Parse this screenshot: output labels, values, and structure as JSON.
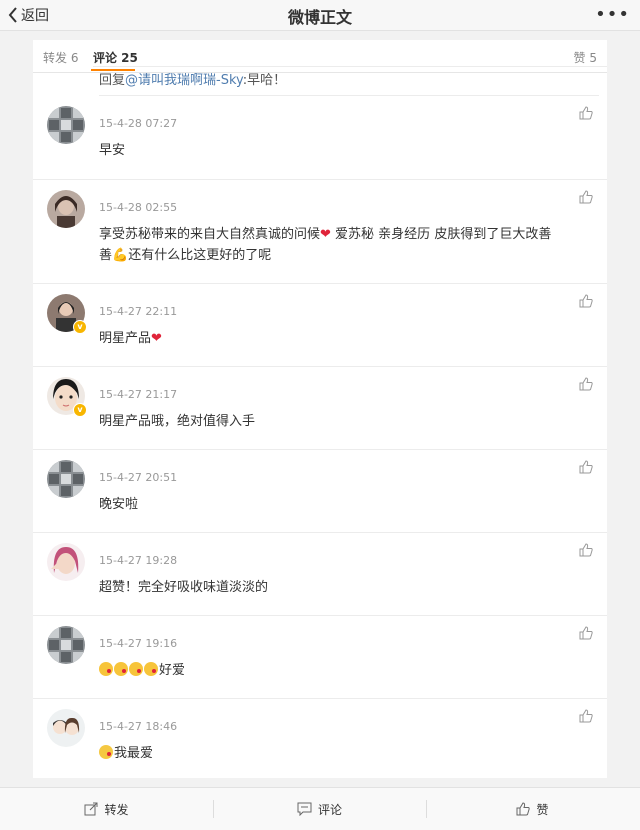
{
  "nav": {
    "back_label": "返回",
    "title": "微博正文",
    "more_label": "•••"
  },
  "tabs": {
    "repost": "转发 6",
    "comment": "评论 25",
    "like": "赞 5"
  },
  "reply_line": {
    "prefix": "回复",
    "mention": "@请叫我瑞啊瑞-Sky",
    "text": ":早哈！"
  },
  "comments": [
    {
      "time": "15-4-28 07:27",
      "text": "早安",
      "verified": false,
      "avatar": "pattern-gray"
    },
    {
      "time": "15-4-28 02:55",
      "text": "享受苏秘带来的来自大自然真诚的问候",
      "text_b": " 爱苏秘 亲身经历 皮肤得到了巨大改善",
      "text_c": "还有什么比这更好的了呢",
      "verified": false,
      "avatar": "person-dark"
    },
    {
      "time": "15-4-27 22:11",
      "text": "明星产品",
      "verified": true,
      "avatar": "person-group"
    },
    {
      "time": "15-4-27 21:17",
      "text": "明星产品哦，绝对值得入手",
      "verified": true,
      "avatar": "girl-face"
    },
    {
      "time": "15-4-27 20:51",
      "text": "晚安啦",
      "verified": false,
      "avatar": "pattern-gray"
    },
    {
      "time": "15-4-27 19:28",
      "text": "超赞！完全好吸收味道淡淡的",
      "verified": false,
      "avatar": "girl-pink"
    },
    {
      "time": "15-4-27 19:16",
      "text": "好爱",
      "verified": false,
      "avatar": "pattern-gray"
    },
    {
      "time": "15-4-27 18:46",
      "text": "我最爱",
      "verified": false,
      "avatar": "cartoon-couple"
    }
  ],
  "bottom": {
    "repost": "转发",
    "comment": "评论",
    "like": "赞"
  },
  "colors": {
    "accent_tab": "#ff8200",
    "mention": "#507daf",
    "verified_badge": "#f8b600"
  }
}
